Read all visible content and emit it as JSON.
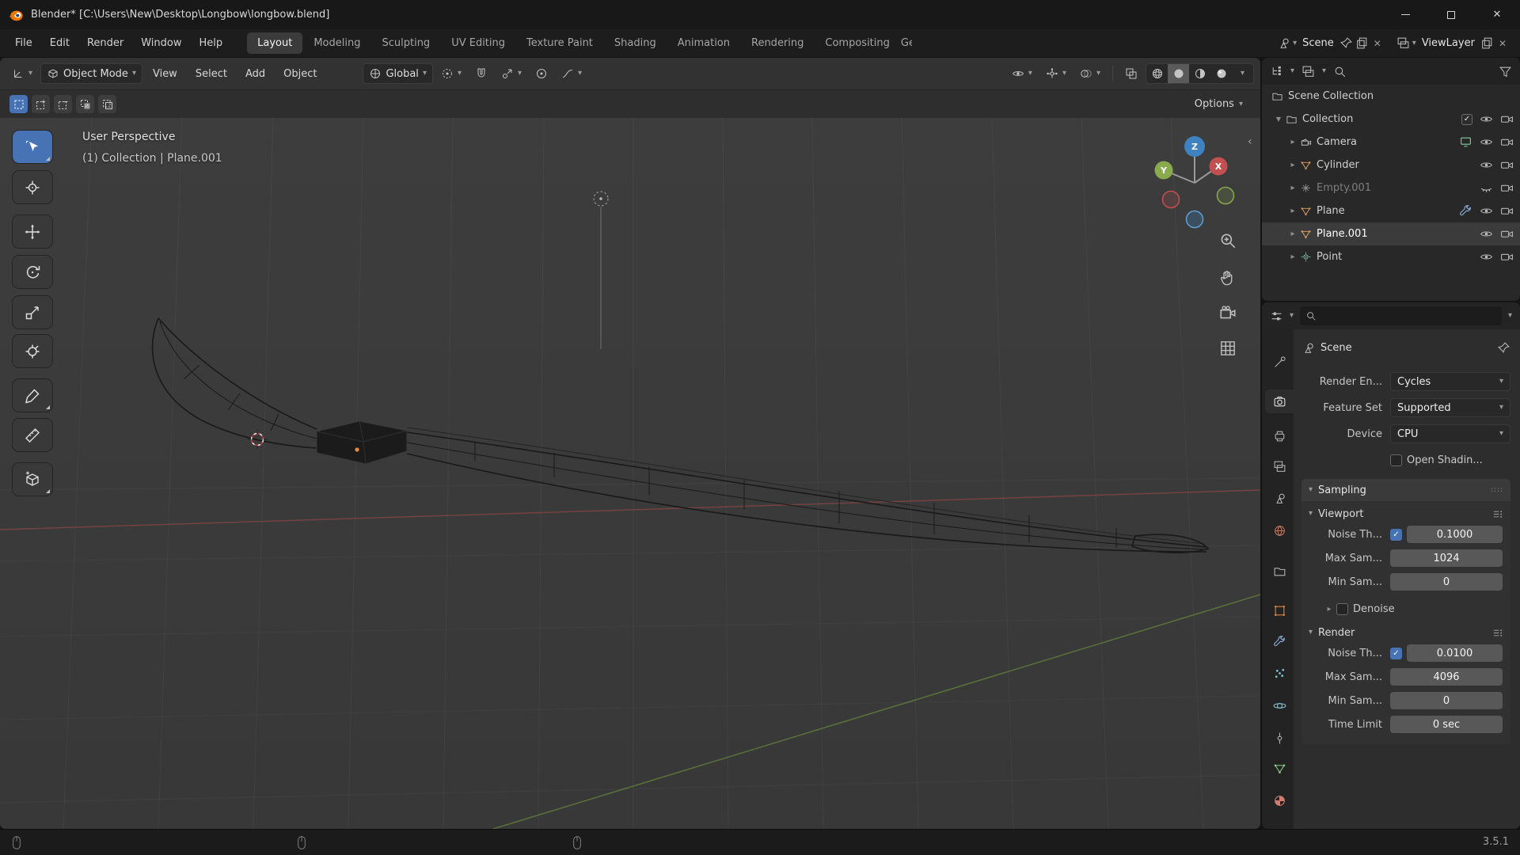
{
  "window": {
    "title": "Blender* [C:\\Users\\New\\Desktop\\Longbow\\longbow.blend]"
  },
  "symbols": {
    "check": "✓",
    "caret_down": "▾",
    "caret_right": "▸",
    "caret_open": "▼",
    "tri_right": "▸",
    "close": "✕",
    "chevron_left": "‹",
    "grip": "::::"
  },
  "topbar": {
    "menus": [
      "File",
      "Edit",
      "Render",
      "Window",
      "Help"
    ],
    "workspaces": [
      "Layout",
      "Modeling",
      "Sculpting",
      "UV Editing",
      "Texture Paint",
      "Shading",
      "Animation",
      "Rendering",
      "Compositing"
    ],
    "active_workspace": "Layout",
    "workspace_clipped": "Geometry Nodes",
    "scene": "Scene",
    "viewlayer": "ViewLayer"
  },
  "vph": {
    "mode": "Object Mode",
    "menus": [
      "View",
      "Select",
      "Add",
      "Object"
    ],
    "orientation": "Global"
  },
  "tool_row": {
    "options": "Options"
  },
  "viewport": {
    "label_perspective": "User Perspective",
    "label_collection": "(1) Collection | Plane.001",
    "gizmo": {
      "x": "X",
      "y": "Y",
      "z": "Z"
    }
  },
  "outliner": {
    "root": "Scene Collection",
    "collection": "Collection",
    "objects": [
      {
        "name": "Camera",
        "type": "camera"
      },
      {
        "name": "Cylinder",
        "type": "mesh"
      },
      {
        "name": "Empty.001",
        "type": "empty",
        "dimmed": true
      },
      {
        "name": "Plane",
        "type": "mesh"
      },
      {
        "name": "Plane.001",
        "type": "mesh",
        "active": true
      },
      {
        "name": "Point",
        "type": "light"
      }
    ]
  },
  "props": {
    "breadcrumb": "Scene",
    "render_engine_label": "Render En...",
    "render_engine_value": "Cycles",
    "feature_set_label": "Feature Set",
    "feature_set_value": "Supported",
    "device_label": "Device",
    "device_value": "CPU",
    "open_shading_label": "Open Shadin...",
    "sampling": {
      "title": "Sampling",
      "viewport": {
        "title": "Viewport",
        "noise_label": "Noise Th...",
        "noise_value": "0.1000",
        "max_label": "Max Sam...",
        "max_value": "1024",
        "min_label": "Min Sam...",
        "min_value": "0",
        "denoise_label": "Denoise"
      },
      "render": {
        "title": "Render",
        "noise_label": "Noise Th...",
        "noise_value": "0.0100",
        "max_label": "Max Sam...",
        "max_value": "4096",
        "min_label": "Min Sam...",
        "min_value": "0",
        "time_label": "Time Limit",
        "time_value": "0 sec"
      }
    }
  },
  "statusbar": {
    "version": "3.5.1"
  },
  "colors": {
    "accent": "#4772b3",
    "axis_x": "#c35050",
    "axis_y": "#89ab4e",
    "axis_z": "#3e83c0",
    "mesh_icon": "#dd9e63",
    "field": "#585858",
    "dropdown": "#282828",
    "viewport_bg": "#3b3b3b"
  }
}
